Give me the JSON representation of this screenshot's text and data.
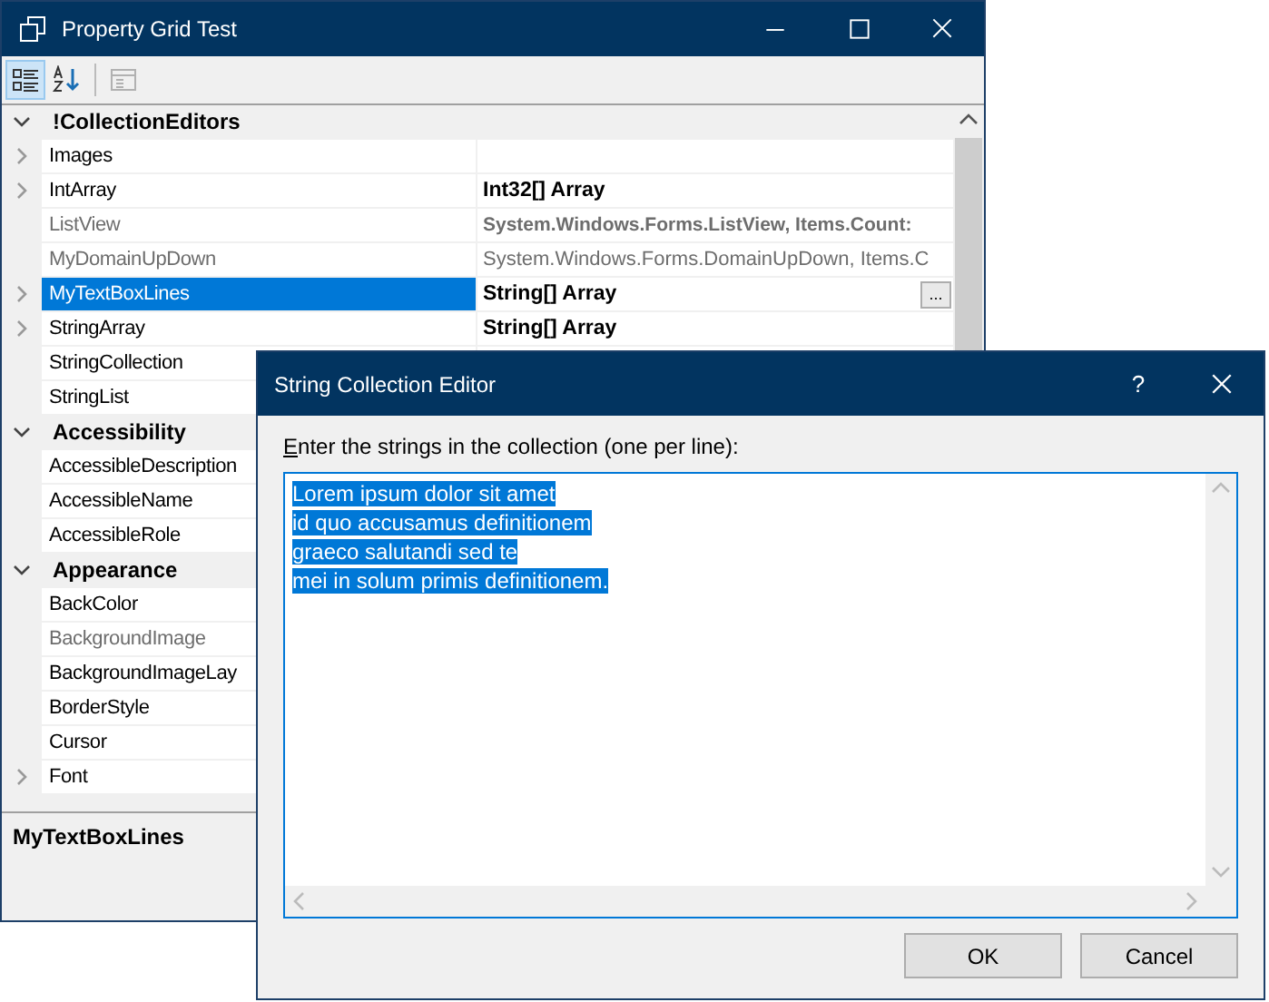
{
  "window": {
    "title": "Property Grid Test"
  },
  "toolbar": [
    {
      "kind": "categorized",
      "selected": true,
      "disabled": false
    },
    {
      "kind": "alphabetical",
      "selected": false,
      "disabled": false
    },
    {
      "kind": "property_pages",
      "selected": false,
      "disabled": true
    }
  ],
  "categories": [
    {
      "name": "!CollectionEditors",
      "expanded": true,
      "properties": [
        {
          "name": "Images",
          "expandable": true,
          "disabled": false,
          "selected": false
        },
        {
          "name": "IntArray",
          "value": "Int32[] Array",
          "modified": true,
          "expandable": true,
          "disabled": false,
          "selected": false
        },
        {
          "name": "ListView",
          "value": "System.Windows.Forms.ListView, Items.Count:",
          "modified": true,
          "expandable": false,
          "disabled": true,
          "selected": false
        },
        {
          "name": "MyDomainUpDown",
          "value": "System.Windows.Forms.DomainUpDown, Items.C",
          "modified": false,
          "expandable": false,
          "disabled": true,
          "selected": false
        },
        {
          "name": "MyTextBoxLines",
          "value": "String[] Array",
          "button": "...",
          "modified": true,
          "expandable": true,
          "disabled": false,
          "selected": true
        },
        {
          "name": "StringArray",
          "value": "String[] Array",
          "modified": true,
          "expandable": true,
          "disabled": false,
          "selected": false
        },
        {
          "name": "StringCollection",
          "expandable": false,
          "disabled": false,
          "selected": false
        },
        {
          "name": "StringList",
          "expandable": false,
          "disabled": false,
          "selected": false
        }
      ]
    },
    {
      "name": "Accessibility",
      "expanded": true,
      "properties": [
        {
          "name": "AccessibleDescription",
          "expandable": false,
          "disabled": false,
          "selected": false
        },
        {
          "name": "AccessibleName",
          "expandable": false,
          "disabled": false,
          "selected": false
        },
        {
          "name": "AccessibleRole",
          "expandable": false,
          "disabled": false,
          "selected": false
        }
      ]
    },
    {
      "name": "Appearance",
      "expanded": true,
      "properties": [
        {
          "name": "BackColor",
          "expandable": false,
          "disabled": false,
          "selected": false
        },
        {
          "name": "BackgroundImage",
          "expandable": false,
          "disabled": true,
          "selected": false
        },
        {
          "name": "BackgroundImageLay",
          "expandable": false,
          "disabled": false,
          "selected": false
        },
        {
          "name": "BorderStyle",
          "expandable": false,
          "disabled": false,
          "selected": false
        },
        {
          "name": "Cursor",
          "expandable": false,
          "disabled": false,
          "selected": false
        },
        {
          "name": "Font",
          "expandable": true,
          "disabled": false,
          "selected": false
        }
      ]
    }
  ],
  "description": {
    "title": "MyTextBoxLines"
  },
  "dialog": {
    "title": "String Collection Editor",
    "help": "?",
    "label": "Enter the strings in the collection (one per line):",
    "lines": [
      "Lorem ipsum dolor sit amet",
      "id quo accusamus definitionem",
      "graeco salutandi sed te",
      "mei in solum primis definitionem."
    ],
    "buttons": [
      {
        "label": "OK"
      },
      {
        "label": "Cancel"
      }
    ]
  }
}
